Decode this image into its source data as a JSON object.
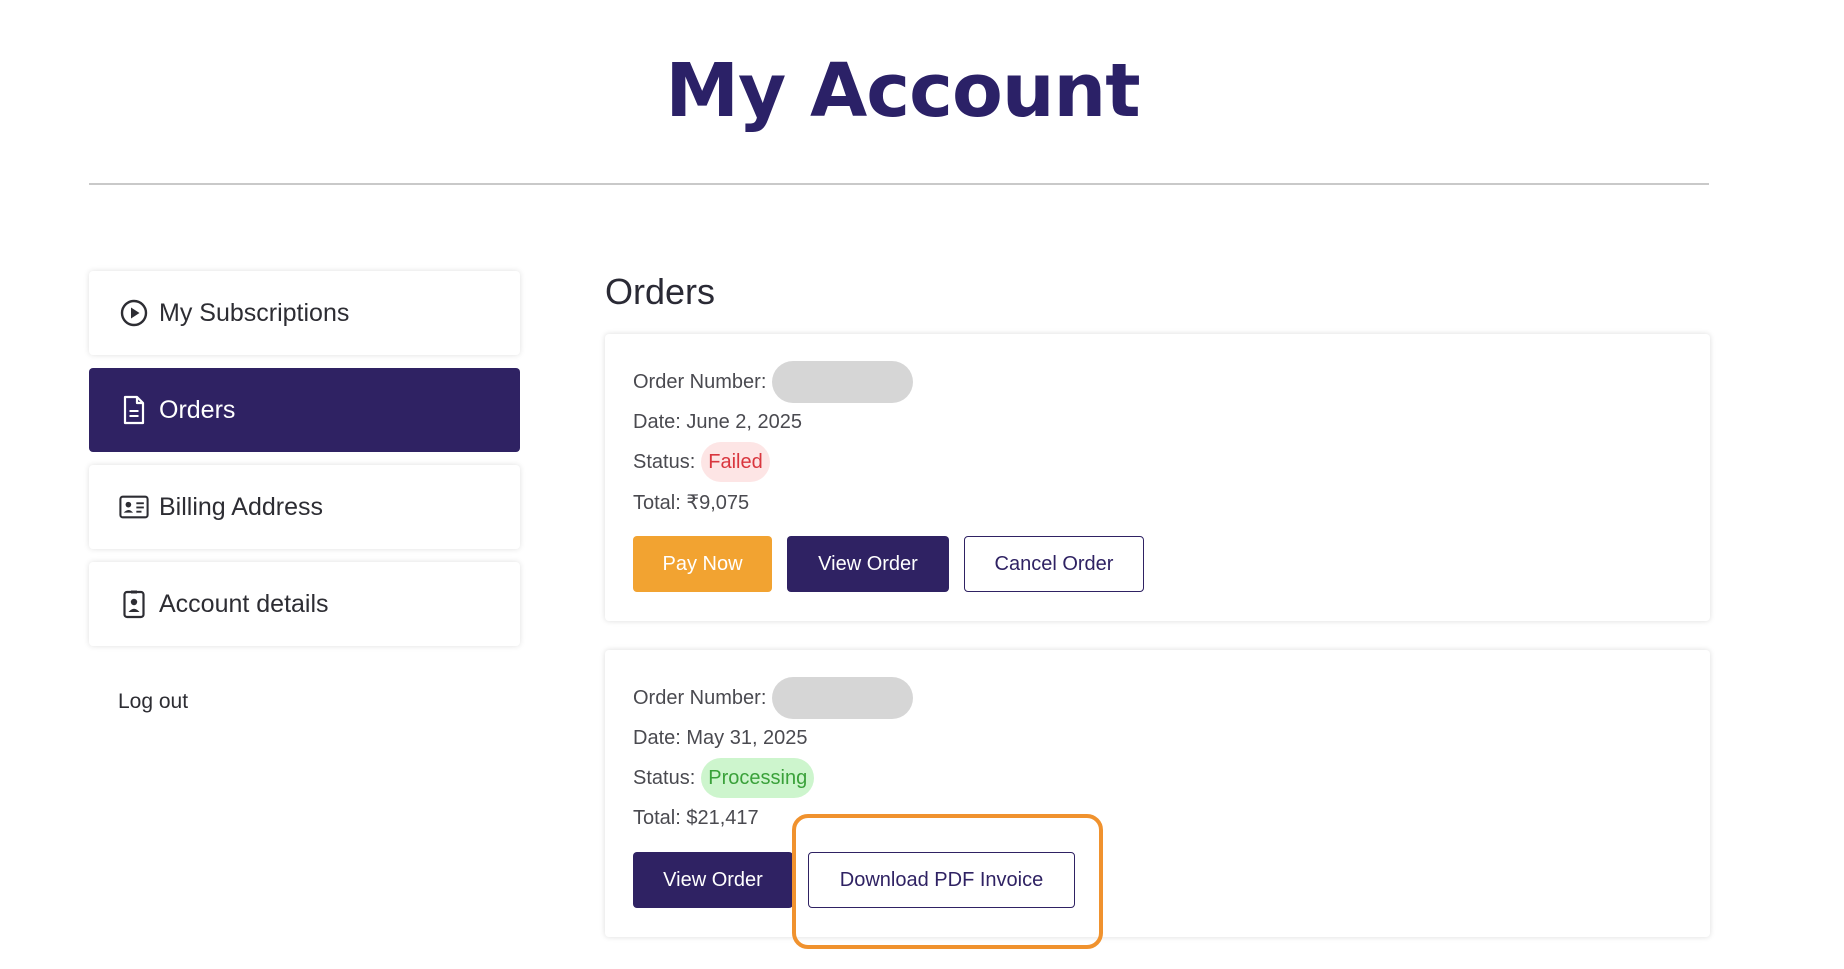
{
  "page": {
    "title": "My Account"
  },
  "sidebar": {
    "items": [
      {
        "label": "My Subscriptions",
        "icon": "play-circle-icon",
        "active": false
      },
      {
        "label": "Orders",
        "icon": "document-icon",
        "active": true
      },
      {
        "label": "Billing Address",
        "icon": "id-card-icon",
        "active": false
      },
      {
        "label": "Account details",
        "icon": "badge-icon",
        "active": false
      }
    ],
    "logout_label": "Log out"
  },
  "main": {
    "section_title": "Orders",
    "orders": [
      {
        "order_number_label": "Order Number:",
        "order_number": "",
        "date_text": "Date: June 2, 2025",
        "status_label": "Status:",
        "status": "Failed",
        "total_text": "Total: ₹9,075",
        "buttons": {
          "pay": "Pay Now",
          "view": "View Order",
          "cancel": "Cancel Order"
        }
      },
      {
        "order_number_label": "Order Number:",
        "order_number": "",
        "date_text": "Date: May 31, 2025",
        "status_label": "Status:",
        "status": "Processing",
        "total_text": "Total: $21,417",
        "buttons": {
          "view": "View Order",
          "download": "Download PDF Invoice"
        }
      }
    ]
  },
  "colors": {
    "brand": "#2f2263",
    "pay_button": "#f2a331",
    "failed_text": "#d9363e",
    "failed_bg": "#fde5e5",
    "processing_text": "#3aa13a",
    "processing_bg": "#cdf5cd",
    "highlight": "#f0922e"
  }
}
